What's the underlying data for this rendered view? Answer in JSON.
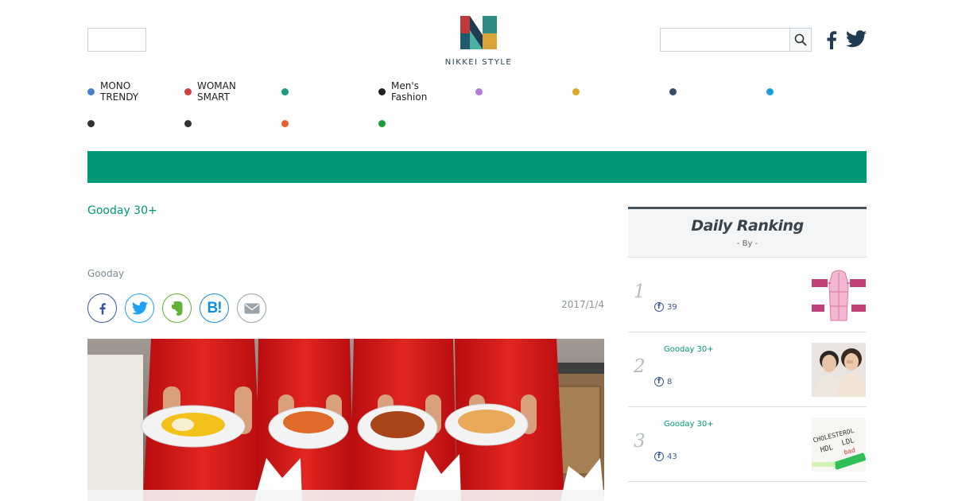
{
  "brand": {
    "logo_text": "NIKKEI STYLE"
  },
  "search": {
    "placeholder": ""
  },
  "nav": {
    "items": [
      {
        "label": "MONO\nTRENDY",
        "color": "#4a7fd0"
      },
      {
        "label": "WOMAN\nSMART",
        "color": "#d04040"
      },
      {
        "label": "",
        "color": "#1a9b7c"
      },
      {
        "label": "Men's\nFashion",
        "color": "#222222"
      },
      {
        "label": "",
        "color": "#b07ad8"
      },
      {
        "label": "",
        "color": "#e0a820"
      },
      {
        "label": "",
        "color": "#3b4a6b"
      },
      {
        "label": "",
        "color": "#1e9ee0"
      },
      {
        "label": "",
        "color": "#333333"
      },
      {
        "label": "",
        "color": "#333333"
      },
      {
        "label": "",
        "color": "#e86030"
      },
      {
        "label": "",
        "color": "#1a9b3c"
      }
    ]
  },
  "article": {
    "category": "Gooday 30+",
    "author": "Gooday",
    "date": "2017/1/4"
  },
  "share": {
    "buttons": [
      {
        "icon": "facebook-icon",
        "color": "#3b5998"
      },
      {
        "icon": "twitter-icon",
        "color": "#1da1f2"
      },
      {
        "icon": "evernote-icon",
        "color": "#5fb336"
      },
      {
        "icon": "hatena-bookmark-icon",
        "color": "#0f8de0"
      },
      {
        "icon": "mail-icon",
        "color": "#9aa3aa"
      }
    ]
  },
  "ranking": {
    "title": "Daily Ranking",
    "by": "- By  -",
    "items": [
      {
        "rank": "1",
        "category": "",
        "likes": "39"
      },
      {
        "rank": "2",
        "category": "Gooday 30+",
        "likes": "8"
      },
      {
        "rank": "3",
        "category": "Gooday 30+",
        "likes": "43"
      }
    ]
  },
  "colors": {
    "accent": "#009877"
  }
}
